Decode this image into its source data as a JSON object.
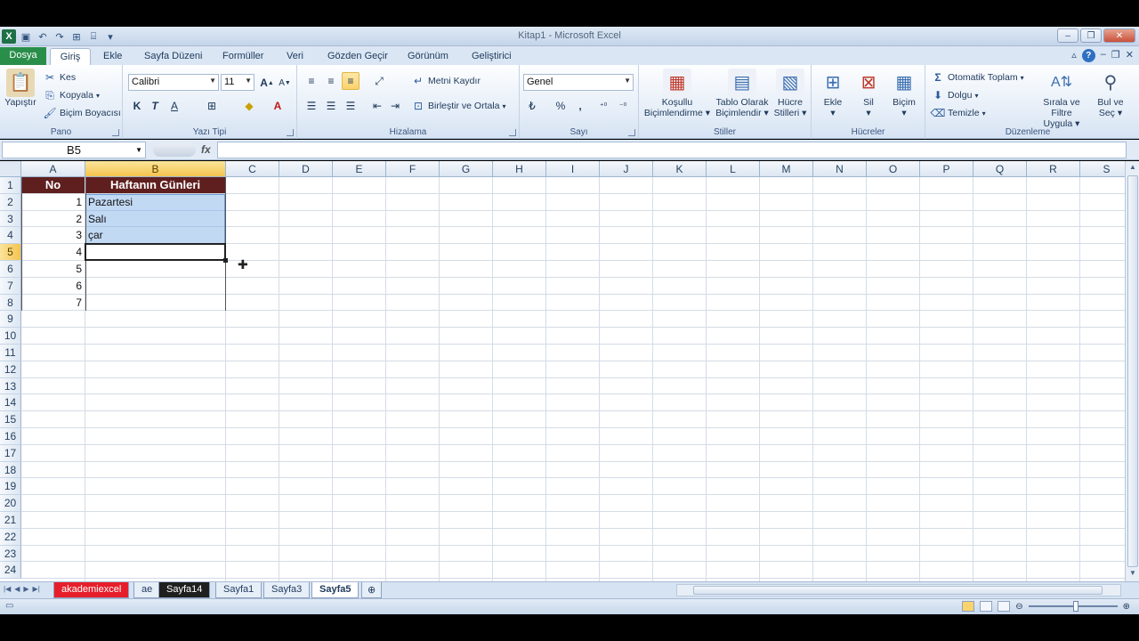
{
  "window": {
    "title": "Kitap1 - Microsoft Excel",
    "controls": [
      "–",
      "❐",
      "✕"
    ]
  },
  "tabs": [
    {
      "label": "Dosya"
    },
    {
      "label": "Giriş"
    },
    {
      "label": "Ekle"
    },
    {
      "label": "Sayfa Düzeni"
    },
    {
      "label": "Formüller"
    },
    {
      "label": "Veri"
    },
    {
      "label": "Gözden Geçir"
    },
    {
      "label": "Görünüm"
    },
    {
      "label": "Geliştirici"
    }
  ],
  "ribbon": {
    "pano": {
      "label": "Pano",
      "paste": "Yapıştır",
      "cut": "Kes",
      "copy": "Kopyala",
      "format_painter": "Biçim Boyacısı"
    },
    "font": {
      "label": "Yazı Tipi",
      "name": "Calibri",
      "size": "11",
      "bold": "K",
      "italic": "T",
      "underline": "A"
    },
    "alignment": {
      "label": "Hizalama",
      "wrap": "Metni Kaydır",
      "merge": "Birleştir ve Ortala"
    },
    "number": {
      "label": "Sayı",
      "format": "Genel",
      "percent": "%",
      "comma": ","
    },
    "styles": {
      "label": "Stiller",
      "conditional": [
        "Koşullu",
        "Biçimlendirme"
      ],
      "as_table": [
        "Tablo Olarak",
        "Biçimlendir"
      ],
      "cell_styles": [
        "Hücre",
        "Stilleri"
      ]
    },
    "cells": {
      "label": "Hücreler",
      "insert": "Ekle",
      "delete": "Sil",
      "format": "Biçim"
    },
    "editing": {
      "label": "Düzenleme",
      "autosum": "Otomatik Toplam",
      "fill": "Dolgu",
      "clear": "Temizle",
      "sort_filter": [
        "Sırala ve Filtre",
        "Uygula"
      ],
      "find_select": [
        "Bul ve",
        "Seç"
      ]
    }
  },
  "formula_bar": {
    "name_box": "B5",
    "fx": "fx",
    "value": ""
  },
  "columns": [
    "A",
    "B",
    "C",
    "D",
    "E",
    "F",
    "G",
    "H",
    "I",
    "J",
    "K",
    "L",
    "M",
    "N",
    "O",
    "P",
    "Q",
    "R",
    "S"
  ],
  "rows": [
    "1",
    "2",
    "3",
    "4",
    "5",
    "6",
    "7",
    "8",
    "9",
    "10",
    "11",
    "12",
    "13",
    "14",
    "15",
    "16",
    "17",
    "18",
    "19",
    "20",
    "21",
    "22",
    "23",
    "24"
  ],
  "table": {
    "headers": [
      "No",
      "Haftanın Günleri"
    ],
    "numbers": [
      "1",
      "2",
      "3",
      "4",
      "5",
      "6",
      "7"
    ],
    "days": [
      "Pazartesi",
      "Salı",
      "çar"
    ]
  },
  "sheets": [
    {
      "label": "akademiexcel",
      "style": "red"
    },
    {
      "label": "ae",
      "style": "normal"
    },
    {
      "label": "Sayfa14",
      "style": "dark"
    },
    {
      "label": "Sayfa1",
      "style": "normal"
    },
    {
      "label": "Sayfa3",
      "style": "normal"
    },
    {
      "label": "Sayfa5",
      "style": "active"
    }
  ],
  "colors": {
    "header_fill": "#5f1f1f",
    "selection": "#78aae6",
    "file_tab": "#2a8e4b"
  }
}
